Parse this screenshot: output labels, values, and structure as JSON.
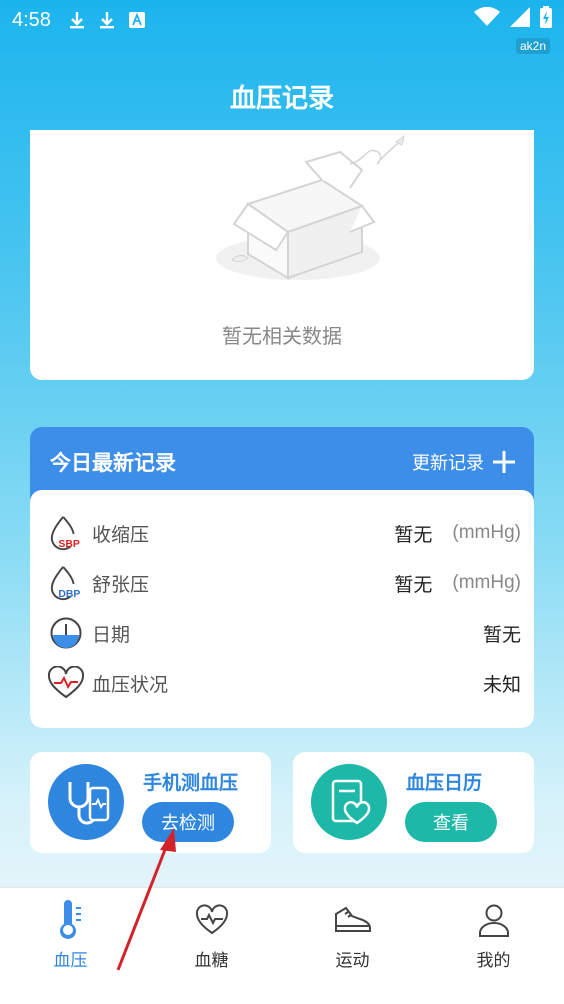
{
  "status_bar": {
    "time": "4:58",
    "app_badge": "ak2n"
  },
  "header": {
    "title": "血压记录"
  },
  "chart_area": {
    "empty_text": "暂无相关数据"
  },
  "today_record": {
    "title": "今日最新记录",
    "update_label": "更新记录",
    "rows": [
      {
        "label": "收缩压",
        "value": "暂无",
        "unit": "(mmHg)",
        "icon": "sbp-icon",
        "icon_text": "SBP"
      },
      {
        "label": "舒张压",
        "value": "暂无",
        "unit": "(mmHg)",
        "icon": "dbp-icon",
        "icon_text": "DBP"
      },
      {
        "label": "日期",
        "value": "暂无",
        "icon": "date-icon"
      },
      {
        "label": "血压状况",
        "value": "未知",
        "icon": "heart-status-icon"
      }
    ]
  },
  "tiles": {
    "phone_measure": {
      "title": "手机测血压",
      "button": "去检测",
      "color": "#2f86de"
    },
    "calendar": {
      "title": "血压日历",
      "button": "查看",
      "color": "#1db8a8"
    }
  },
  "bottom_nav": {
    "items": [
      {
        "label": "血压",
        "icon": "thermometer-icon",
        "active": true
      },
      {
        "label": "血糖",
        "icon": "heart-pulse-icon",
        "active": false
      },
      {
        "label": "运动",
        "icon": "sneaker-icon",
        "active": false
      },
      {
        "label": "我的",
        "icon": "user-icon",
        "active": false
      }
    ]
  },
  "colors": {
    "accent": "#3c8ee8",
    "teal": "#1db8a8",
    "header_bg": "#1cb4ee"
  }
}
